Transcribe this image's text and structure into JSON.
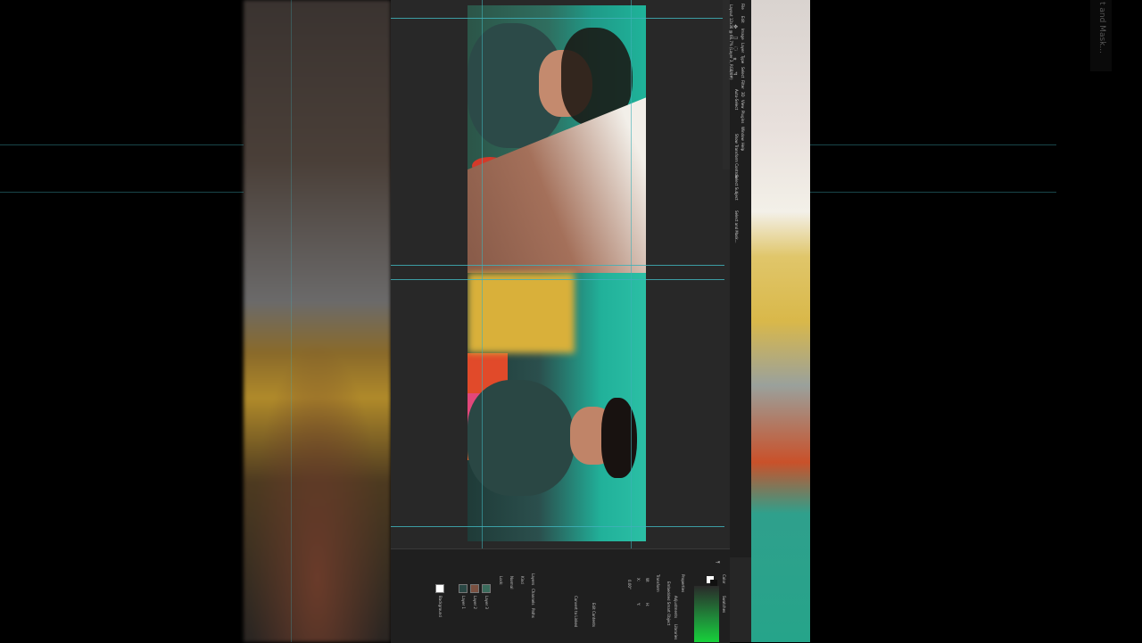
{
  "window": {
    "doc_tab": "Layout 12x36 @ 66.7% (Layer 3, RGB/8#)"
  },
  "menu": [
    "File",
    "Edit",
    "Image",
    "Layer",
    "Type",
    "Select",
    "Filter",
    "3D",
    "View",
    "Plugins",
    "Window",
    "Help"
  ],
  "toolbar_options": {
    "auto_select": "Auto-Select",
    "layer_label": "Layer",
    "transform_controls": "Show Transform Controls"
  },
  "panels": {
    "tabs": [
      "Layers",
      "Channels",
      "Paths"
    ],
    "filter": "Kind",
    "blend_mode": "Normal",
    "opacity_label": "Opacity:",
    "lock_label": "Lock:",
    "fill_label": "Fill:",
    "layers": [
      "Layer 3",
      "Layer 2",
      "Layer 1",
      "Background"
    ],
    "properties_title": "Properties",
    "properties_tabs": [
      "Adjustments",
      "Libraries"
    ],
    "smart_object": "Embedded Smart Object",
    "transform_label": "Transform",
    "w_label": "W:",
    "h_label": "H:",
    "x_label": "X:",
    "y_label": "Y:",
    "rotation": "0.00°",
    "edit_contents": "Edit Contents",
    "convert_linked": "Convert to Linked",
    "color_title": "Color",
    "swatches": "Swatches"
  },
  "side_buttons": {
    "select_subject": "Select Subject",
    "select_mask": "Select and Mask..."
  },
  "overlay_text": "t and Mask...",
  "colors": {
    "guide": "#3fb0b8",
    "accent_green": "#17d13a",
    "canvas_bg": "#282828"
  },
  "icons": [
    "move-tool-icon",
    "marquee-icon",
    "lasso-icon",
    "crop-icon",
    "eyedropper-icon",
    "brush-icon",
    "eraser-icon",
    "text-icon",
    "hand-icon",
    "zoom-icon"
  ]
}
